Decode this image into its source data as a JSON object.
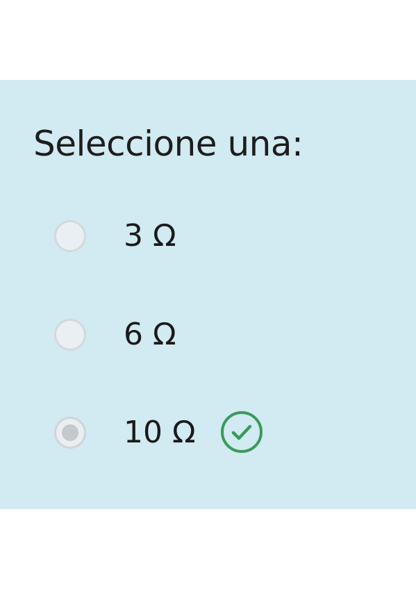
{
  "question": {
    "prompt": "Seleccione una:",
    "options": [
      {
        "label": "3 Ω",
        "selected": false
      },
      {
        "label": "6 Ω",
        "selected": false
      },
      {
        "label": "10 Ω",
        "selected": true,
        "status": "correct"
      }
    ]
  },
  "icons": {
    "correct": "check-circle-icon"
  },
  "colors": {
    "panel_background": "#d2eaf1",
    "correct_green": "#3a9a5c"
  }
}
